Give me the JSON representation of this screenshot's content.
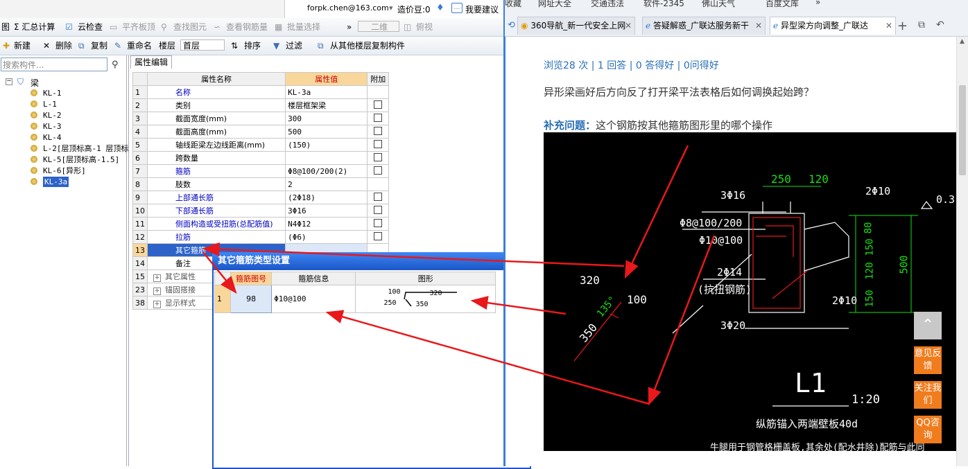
{
  "user_bar": {
    "email": "forpk.chen@163.com",
    "coins": "造价豆:0",
    "suggest": "我要建议"
  },
  "toolbar1": {
    "items": [
      "图",
      "Σ 汇总计算",
      "云检查",
      "平齐板顶",
      "查找图元",
      "查看钢筋量",
      "批量选择",
      "»",
      "二维",
      "俯视"
    ]
  },
  "toolbar2": {
    "new": "新建",
    "delete": "删除",
    "copy": "复制",
    "rename": "重命名",
    "floor_label": "楼层",
    "floor_value": "首层",
    "sort": "排序",
    "filter": "过滤",
    "copy_from": "从其他楼层复制构件"
  },
  "search": {
    "placeholder": "搜索构件..."
  },
  "tree": {
    "root": "梁",
    "items": [
      "KL-1",
      "L-1",
      "KL-2",
      "KL-3",
      "KL-4",
      "L-2[层顶标高-1 层顶标",
      "KL-5[层顶标高-1.5]",
      "KL-6[异形]",
      "KL-3a"
    ],
    "selected": "KL-3a"
  },
  "prop_tab": "属性编辑",
  "prop_headers": {
    "name": "属性名称",
    "value": "属性值",
    "extra": "附加"
  },
  "props": [
    {
      "n": "1",
      "name": "名称",
      "value": "KL-3a",
      "chk": false
    },
    {
      "n": "2",
      "name": "类别",
      "value": "楼层框架梁",
      "chk": true
    },
    {
      "n": "3",
      "name": "截面宽度(mm)",
      "value": "300",
      "chk": true
    },
    {
      "n": "4",
      "name": "截面高度(mm)",
      "value": "500",
      "chk": true
    },
    {
      "n": "5",
      "name": "轴线距梁左边线距离(mm)",
      "value": "(150)",
      "chk": true
    },
    {
      "n": "6",
      "name": "跨数量",
      "value": "",
      "chk": true
    },
    {
      "n": "7",
      "name": "箍筋",
      "value": "Φ8@100/200(2)",
      "chk": true
    },
    {
      "n": "8",
      "name": "肢数",
      "value": "2",
      "chk": false
    },
    {
      "n": "9",
      "name": "上部通长筋",
      "value": "(2Φ18)",
      "chk": true
    },
    {
      "n": "10",
      "name": "下部通长筋",
      "value": "3Φ16",
      "chk": true
    },
    {
      "n": "11",
      "name": "侧面构造或受扭筋(总配筋值)",
      "value": "N4Φ12",
      "chk": true
    },
    {
      "n": "12",
      "name": "拉筋",
      "value": "(Φ6)",
      "chk": true
    },
    {
      "n": "13",
      "name": "其它箍筋",
      "value": "",
      "chk": false
    },
    {
      "n": "14",
      "name": "备注",
      "value": "",
      "chk": false
    },
    {
      "n": "15",
      "name": "其它属性",
      "value": "",
      "chk": false
    },
    {
      "n": "23",
      "name": "锚固搭接",
      "value": "",
      "chk": false
    },
    {
      "n": "38",
      "name": "显示样式",
      "value": "",
      "chk": false
    }
  ],
  "dialog": {
    "title": "其它箍筋类型设置",
    "headers": [
      "箍筋图号",
      "箍筋信息",
      "图形"
    ],
    "row": {
      "n": "1",
      "id": "98",
      "info": "Φ10@100",
      "shape_a": "100",
      "shape_b": "320",
      "shape_c": "250",
      "shape_d": "350"
    }
  },
  "browser": {
    "bookmarks": [
      "收藏",
      "网址大全",
      "交通违法",
      "软件-2345",
      "佛山天气",
      "百度文库",
      "»"
    ],
    "tabs": [
      "360导航_新一代安全上网",
      "答疑解惑_广联达服务新干",
      "异型梁方向调整_广联达"
    ],
    "stats": "浏览28 次 | 1 回答 | 0 答得好 | 0问得好",
    "question": "异形梁画好后方向反了打开梁平法表格后如何调换起始跨？",
    "supp_label": "补充问题：",
    "supp_text": "这个钢筋按其他箍筋图形里的哪个操作",
    "side_buttons": [
      "意见反馈",
      "关注我们",
      "QQ咨询"
    ]
  },
  "cad": {
    "dim_top1": "250",
    "dim_top2": "120",
    "r_top": "3Φ16",
    "r_right_top": "2Φ10",
    "stirrup1": "Φ8@100/200",
    "stirrup2": "Φ10@100",
    "r_mid": "2Φ14",
    "r_mid_note": "(抗扭钢筋)",
    "r_right_bot": "2Φ10",
    "r_bot": "3Φ20",
    "dim_320": "320",
    "dim_100": "100",
    "dim_350": "350",
    "angle": "135°",
    "dim_v80": "80",
    "dim_v150a": "150",
    "dim_v120": "120",
    "dim_v150b": "150",
    "dim_500": "500",
    "elev": "0.3",
    "title": "L1",
    "scale": "1:20",
    "note1": "纵筋锚入两端壁板40d",
    "note2": "牛腿用于钢管格栅盖板,其余处(配水井除)配筋与此同"
  },
  "colors": {
    "annotation_arrow": "#e8181b",
    "cad_bg": "#000000",
    "accent_blue": "#1b56c6"
  }
}
